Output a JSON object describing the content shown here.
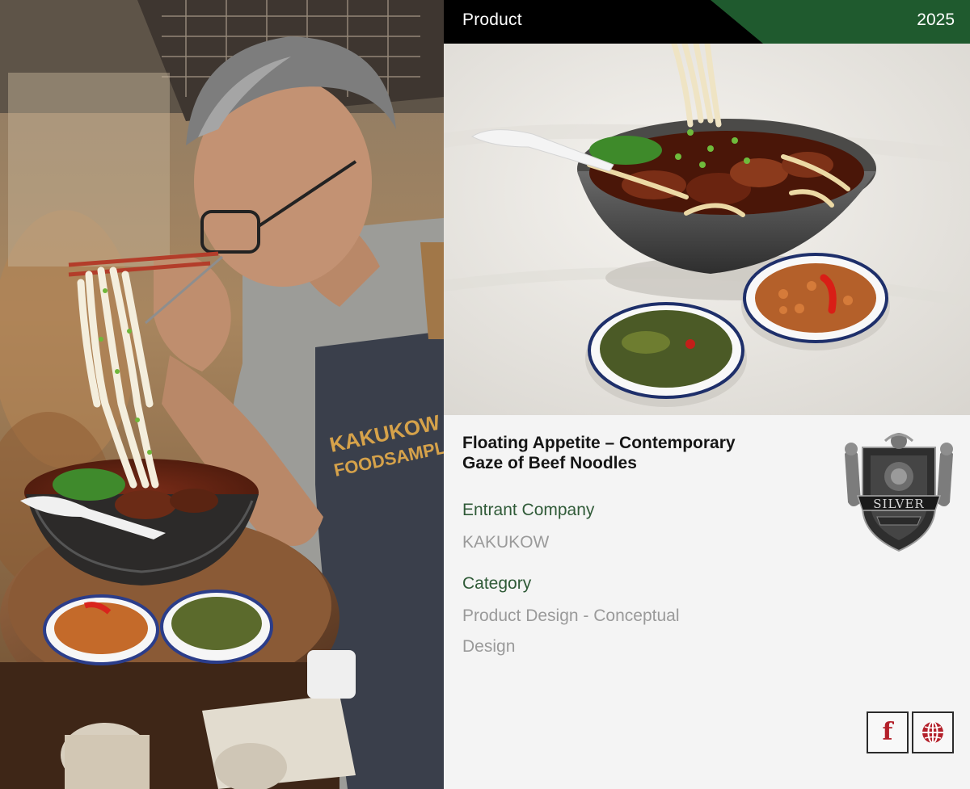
{
  "header": {
    "label": "Product",
    "year": "2025"
  },
  "entry": {
    "title_line1": "Floating Appetite – Contemporary",
    "title_line2": "Gaze of Beef Noodles",
    "entrant_label": "Entrant Company",
    "entrant_value": "KAKUKOW",
    "category_label": "Category",
    "category_line1": "Product Design - Conceptual",
    "category_line2": "Design"
  },
  "award": {
    "level": "SILVER",
    "badge_icon": "laurel-crest-icon"
  },
  "photo_left": {
    "apron_text_1": "KAKUKOW",
    "apron_text_2": "FOODSAMPLE"
  },
  "social": {
    "facebook_icon": "facebook-icon",
    "website_icon": "globe-icon"
  },
  "colors": {
    "brand_green": "#1f5a2e",
    "label_green": "#2f5a37",
    "value_grey": "#9a9a9a",
    "accent_red": "#b3202a"
  }
}
